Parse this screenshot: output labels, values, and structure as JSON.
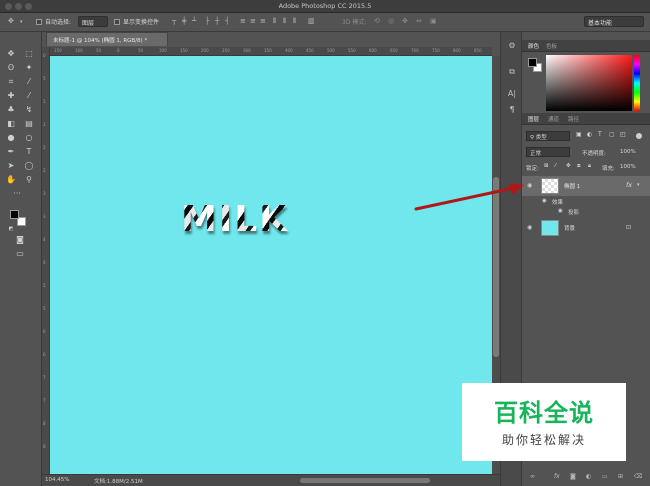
{
  "window": {
    "title": "Adobe Photoshop CC 2015.5"
  },
  "options_bar": {
    "auto_select_label": "自动选择:",
    "auto_select_value": "图层",
    "show_transform_label": "显示变换控件",
    "mode_3d_label": "3D 模式:",
    "workspace": "基本功能"
  },
  "document": {
    "tab_title": "未标题-1 @ 104% (椭圆 1, RGB/8) *",
    "canvas_color": "#70e7ec",
    "text": "MILK",
    "ruler_marks": [
      "150",
      "100",
      "50",
      "0",
      "50",
      "100",
      "150",
      "200",
      "250",
      "300",
      "350",
      "400",
      "450",
      "500",
      "550",
      "600",
      "650",
      "700",
      "750",
      "800",
      "850"
    ]
  },
  "status": {
    "zoom": "104.45%",
    "doc_size": "文档:1.88M/2.51M"
  },
  "color_panel": {
    "tabs": [
      "颜色",
      "色板"
    ],
    "foreground": "#000000",
    "background": "#ffffff"
  },
  "layers_panel": {
    "tabs": [
      "图层",
      "通道",
      "路径"
    ],
    "filter_label": "类型",
    "blend_mode": "正常",
    "opacity_label": "不透明度:",
    "opacity_value": "100%",
    "lock_label": "锁定:",
    "fill_label": "填充:",
    "fill_value": "100%",
    "layers": [
      {
        "name": "椭圆 1",
        "fx": "fx",
        "effects_label": "效果",
        "effects": [
          "投影"
        ]
      },
      {
        "name": "背景"
      }
    ]
  },
  "watermark": {
    "title": "百科全说",
    "subtitle": "助你轻松解决",
    "color": "#19b45a"
  },
  "annotation": {
    "arrow_color": "#b01818"
  }
}
